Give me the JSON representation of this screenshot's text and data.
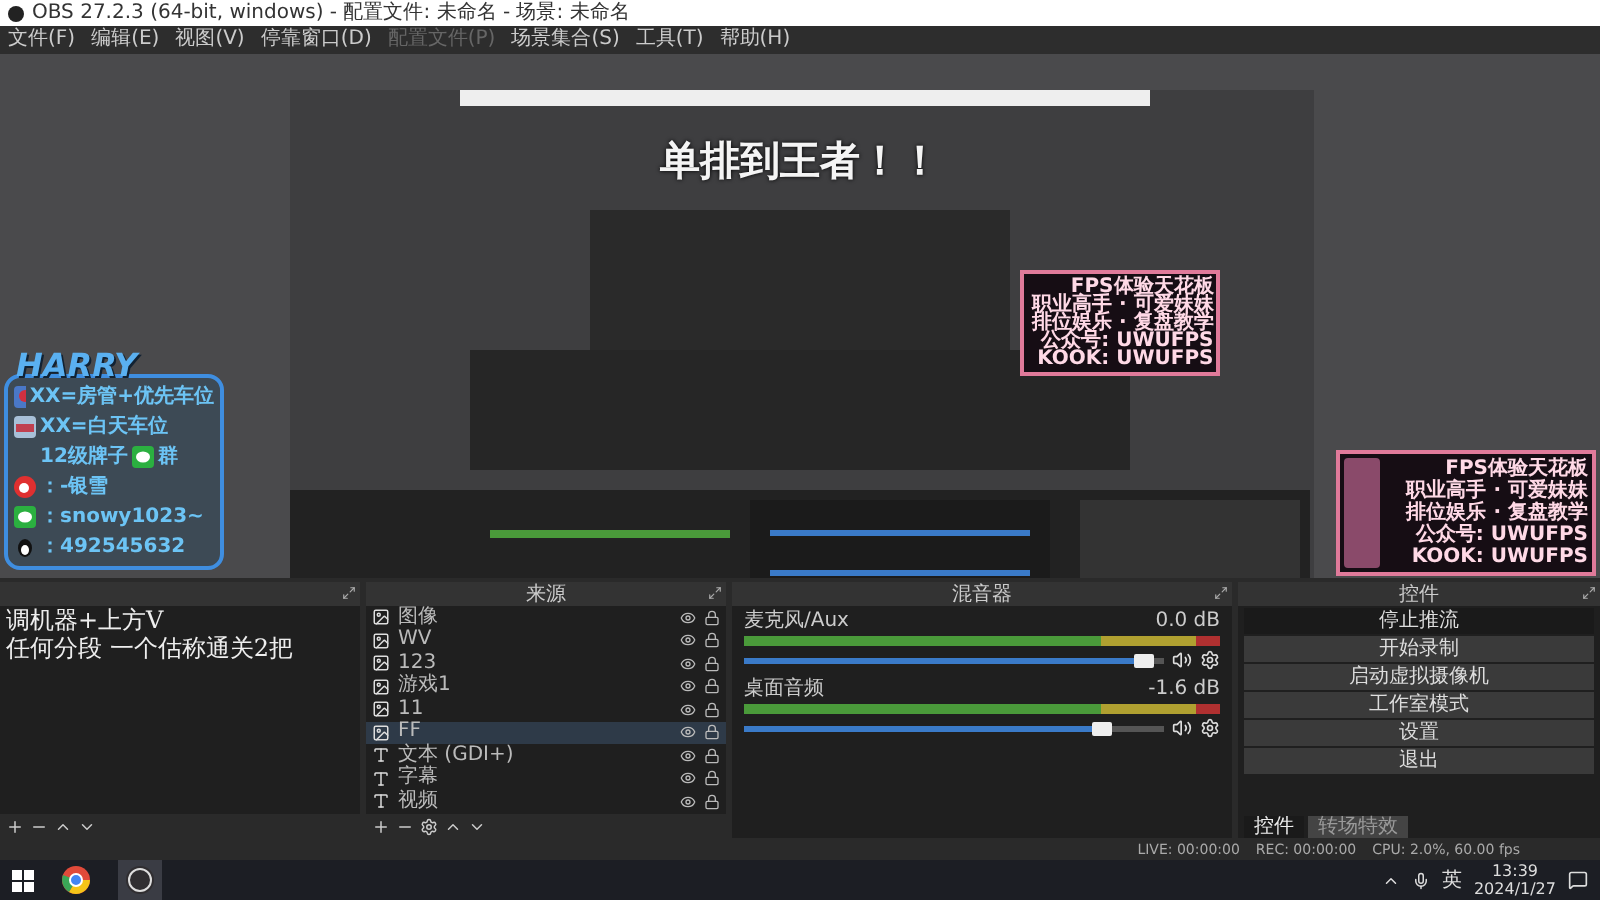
{
  "window": {
    "title": "OBS 27.2.3 (64-bit, windows) - 配置文件: 未命名 - 场景: 未命名"
  },
  "menu": [
    {
      "label": "文件(F)",
      "disabled": false
    },
    {
      "label": "编辑(E)",
      "disabled": false
    },
    {
      "label": "视图(V)",
      "disabled": false
    },
    {
      "label": "停靠窗口(D)",
      "disabled": false
    },
    {
      "label": "配置文件(P)",
      "disabled": true
    },
    {
      "label": "场景集合(S)",
      "disabled": false
    },
    {
      "label": "工具(T)",
      "disabled": false
    },
    {
      "label": "帮助(H)",
      "disabled": false
    }
  ],
  "preview": {
    "headline": "单排到王者！！",
    "info_card": {
      "logo": "HARRY",
      "lines": [
        {
          "kind": "badge",
          "text": "XX=房管+优先车位"
        },
        {
          "kind": "car",
          "text": "XX=白天车位"
        },
        {
          "kind": "group",
          "text": "12级牌子",
          "suffix": "群"
        },
        {
          "kind": "weibo",
          "text": "：-银雪"
        },
        {
          "kind": "wechat",
          "text": "：snowy1023~"
        },
        {
          "kind": "qq",
          "text": "：492545632"
        }
      ]
    },
    "promo_cards": [
      {
        "lines": [
          "FPS体验天花板",
          "职业高手 · 可爱妹妹",
          "排位娱乐 · 复盘教学",
          "公众号: UWUFPS",
          "KOOK: UWUFPS"
        ]
      },
      {
        "lines": [
          "FPS体验天花板",
          "职业高手 · 可爱妹妹",
          "排位娱乐 · 复盘教学",
          "公众号: UWUFPS",
          "KOOK: UWUFPS"
        ]
      }
    ]
  },
  "scenes_dock": {
    "overlay_lines": [
      "调机器+上方V",
      "任何分段 一个估称通关2把"
    ]
  },
  "sources": {
    "title": "来源",
    "items": [
      {
        "name": "图像",
        "kind": "image",
        "visible": true,
        "selected": false
      },
      {
        "name": "WV",
        "kind": "image",
        "visible": true,
        "selected": false
      },
      {
        "name": "123",
        "kind": "image",
        "visible": true,
        "selected": false
      },
      {
        "name": "游戏1",
        "kind": "image",
        "visible": true,
        "selected": false
      },
      {
        "name": "11",
        "kind": "image",
        "visible": true,
        "selected": false
      },
      {
        "name": "FF",
        "kind": "image",
        "visible": true,
        "selected": true
      },
      {
        "name": "文本 (GDI+)",
        "kind": "text",
        "visible": true,
        "selected": false
      },
      {
        "name": "字幕",
        "kind": "text",
        "visible": true,
        "selected": false
      },
      {
        "name": "视频",
        "kind": "text",
        "visible": true,
        "selected": false
      }
    ]
  },
  "mixer": {
    "title": "混音器",
    "channels": [
      {
        "name": "麦克风/Aux",
        "reading": "0.0 dB",
        "level": 0.95,
        "muted": false
      },
      {
        "name": "桌面音频",
        "reading": "-1.6 dB",
        "level": 0.85,
        "muted": false
      }
    ]
  },
  "controls": {
    "title": "控件",
    "buttons": [
      {
        "label": "停止推流",
        "active": true
      },
      {
        "label": "开始录制",
        "active": false
      },
      {
        "label": "启动虚拟摄像机",
        "active": false
      },
      {
        "label": "工作室模式",
        "active": false
      },
      {
        "label": "设置",
        "active": false
      },
      {
        "label": "退出",
        "active": false
      }
    ],
    "tabs": [
      {
        "label": "控件",
        "selected": true
      },
      {
        "label": "转场特效",
        "selected": false
      }
    ]
  },
  "status_bar": {
    "live": "LIVE: 00:00:00",
    "rec": "REC: 00:00:00",
    "cpu": "CPU: 2.0%, 60.00 fps"
  },
  "taskbar": {
    "ime": "英",
    "time": "13:39",
    "date": "2024/1/27"
  }
}
